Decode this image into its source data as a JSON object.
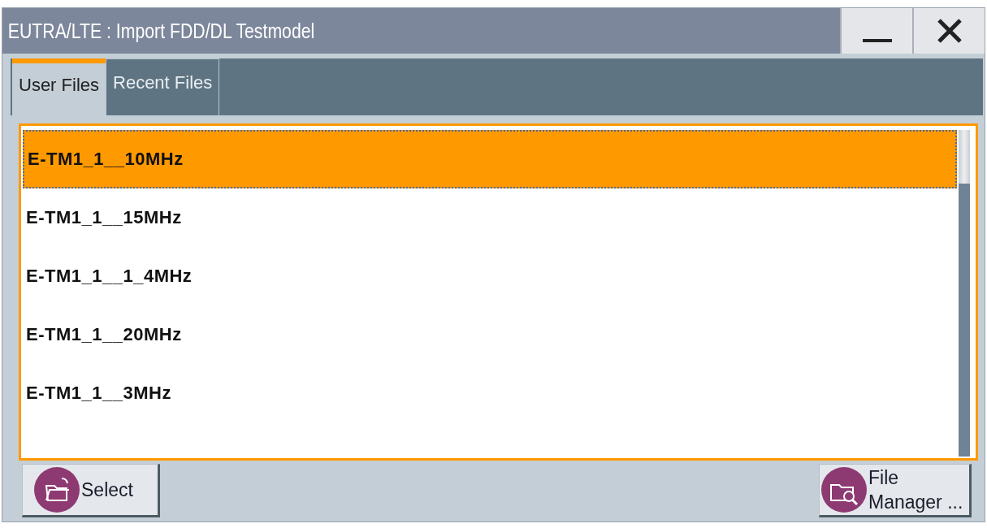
{
  "window": {
    "title": "EUTRA/LTE : Import FDD/DL Testmodel"
  },
  "tabs": [
    {
      "label": "User Files",
      "selected": true
    },
    {
      "label": "Recent Files",
      "selected": false
    }
  ],
  "files": [
    {
      "name": "E-TM1_1__10MHz",
      "selected": true
    },
    {
      "name": "E-TM1_1__15MHz",
      "selected": false
    },
    {
      "name": "E-TM1_1__1_4MHz",
      "selected": false
    },
    {
      "name": "E-TM1_1__20MHz",
      "selected": false
    },
    {
      "name": "E-TM1_1__3MHz",
      "selected": false
    }
  ],
  "buttons": [
    {
      "kind": "select",
      "label": "Select"
    },
    {
      "kind": "file-manager",
      "label": "File\nManager ..."
    }
  ]
}
